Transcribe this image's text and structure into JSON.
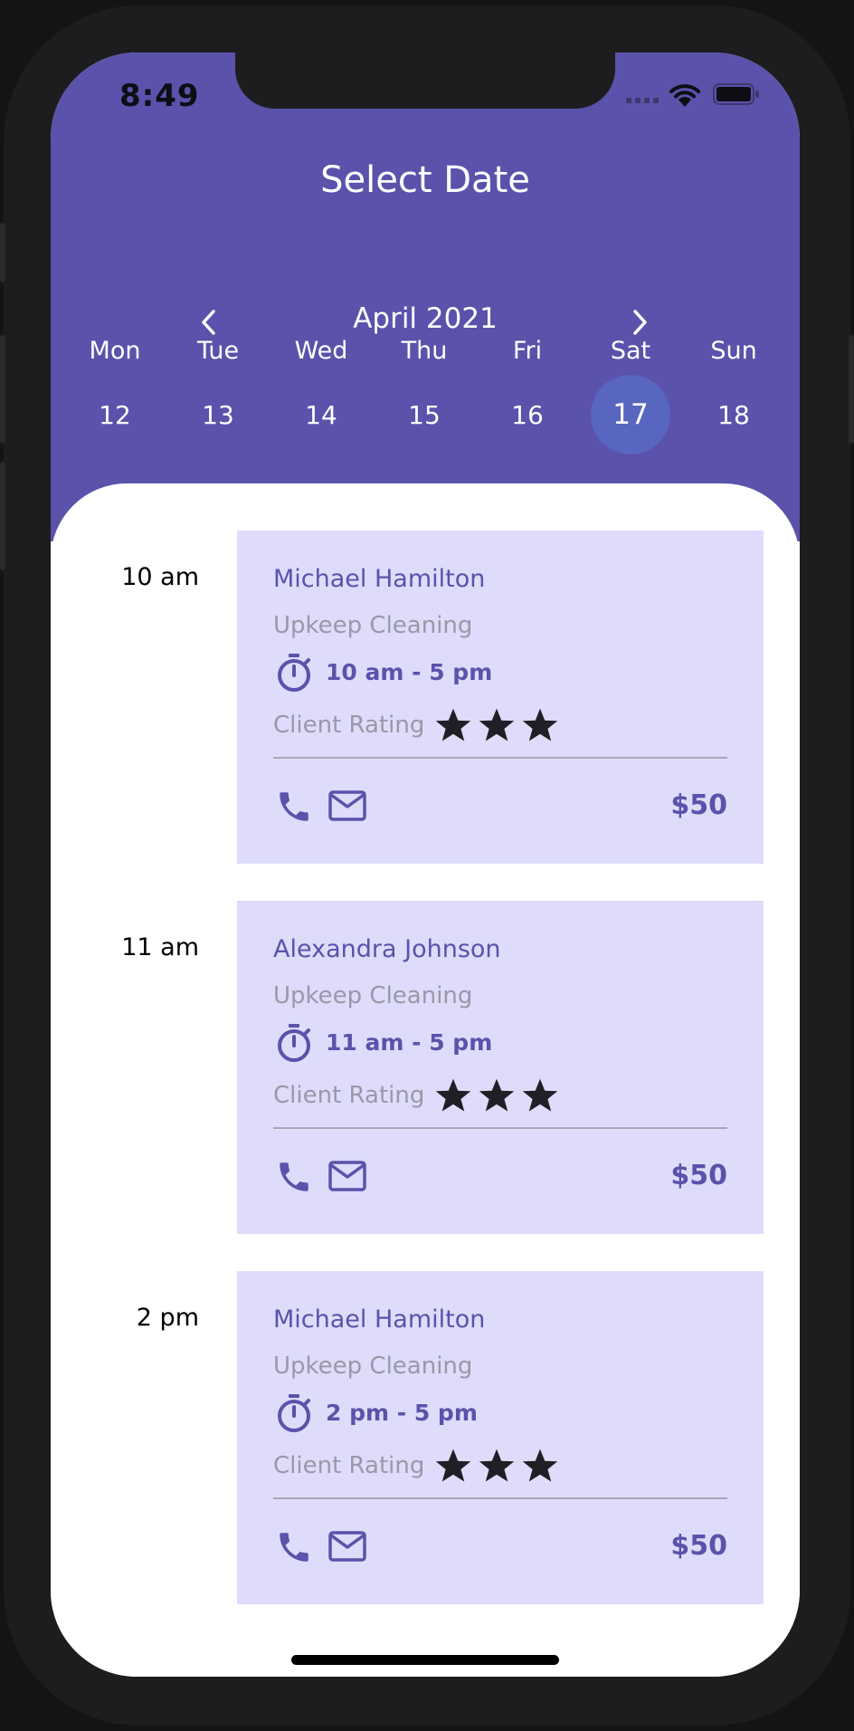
{
  "status_bar": {
    "time": "8:49"
  },
  "header": {
    "title": "Select Date",
    "month": "April 2021",
    "weekdays": [
      "Mon",
      "Tue",
      "Wed",
      "Thu",
      "Fri",
      "Sat",
      "Sun"
    ],
    "dates": [
      "12",
      "13",
      "14",
      "15",
      "16",
      "17",
      "18"
    ],
    "selected_date": "17"
  },
  "colors": {
    "accent": "#5b52ab",
    "selected_date_circle": "#5866bf",
    "card_background": "#dedcfa",
    "muted_text": "#9a98a8"
  },
  "icons": [
    "wifi-icon",
    "battery-icon",
    "chevron-left-icon",
    "chevron-right-icon",
    "timer-icon",
    "star-icon",
    "phone-icon",
    "mail-icon"
  ],
  "appointments": [
    {
      "time": "10 am",
      "client": "Michael Hamilton",
      "service": "Upkeep Cleaning",
      "hours": "10 am - 5 pm",
      "rating_label": "Client Rating",
      "rating": 3,
      "price": "$50"
    },
    {
      "time": "11 am",
      "client": "Alexandra Johnson",
      "service": "Upkeep Cleaning",
      "hours": "11 am - 5 pm",
      "rating_label": "Client Rating",
      "rating": 3,
      "price": "$50"
    },
    {
      "time": "2 pm",
      "client": "Michael Hamilton",
      "service": "Upkeep Cleaning",
      "hours": "2 pm - 5 pm",
      "rating_label": "Client Rating",
      "rating": 3,
      "price": "$50"
    }
  ]
}
